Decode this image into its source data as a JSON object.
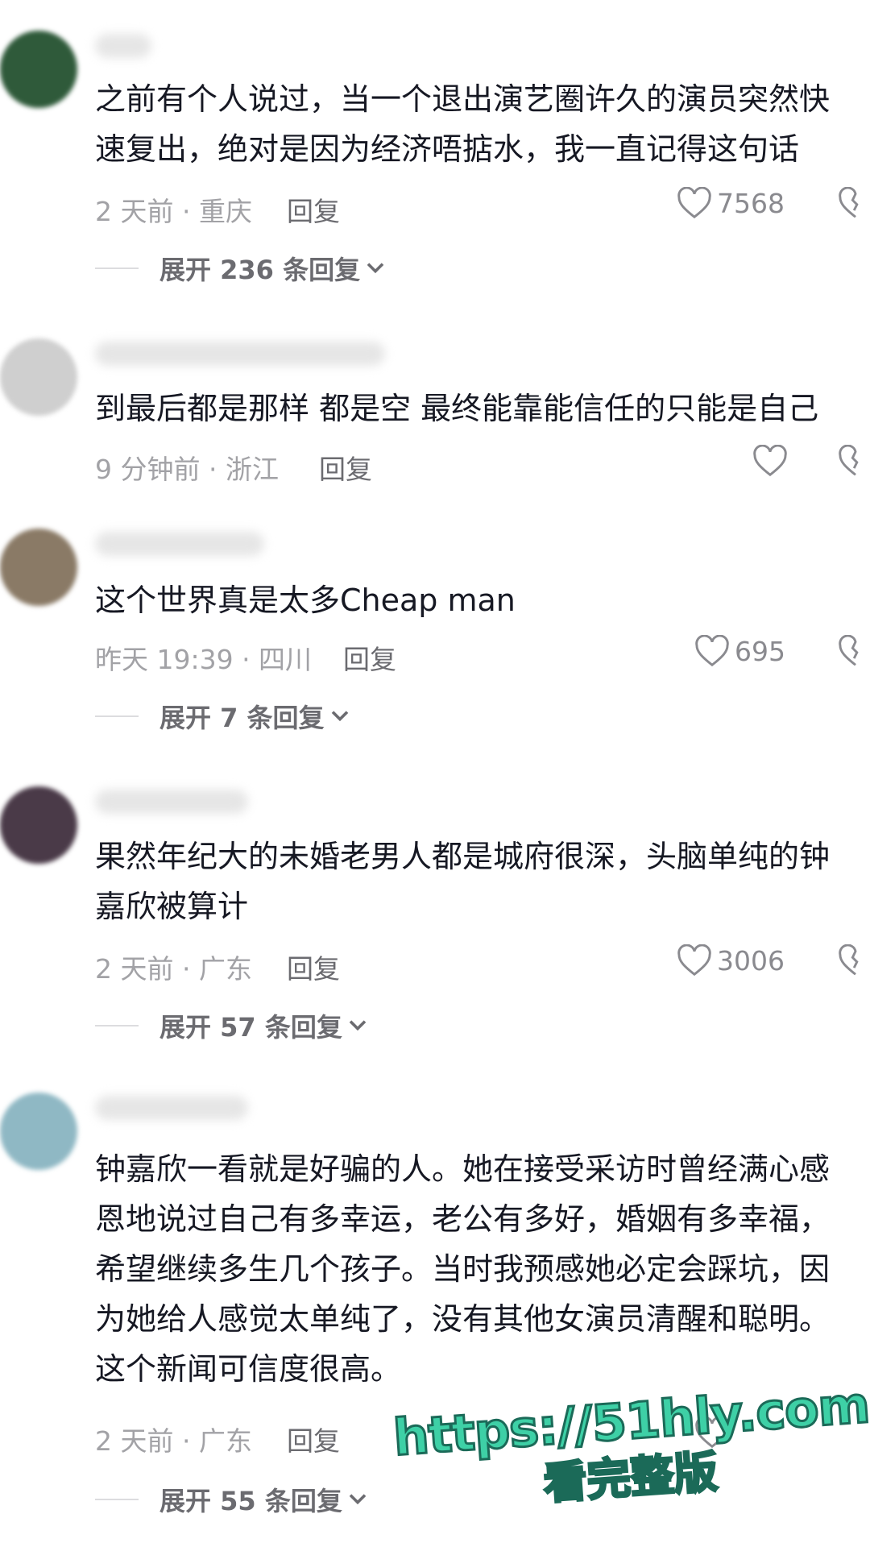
{
  "comments": [
    {
      "lines": [
        "之前有个人说过，当一个退出演艺圈许久的演员突然快",
        "速复出，绝对是因为经济唔掂水，我一直记得这句话"
      ],
      "time_location": "2 天前 · 重庆",
      "reply_label": "回复",
      "likes": "7568",
      "expand_label": "展开 236 条回复",
      "avatar_color": "#2f5a3a"
    },
    {
      "lines": [
        "到最后都是那样 都是空 最终能靠能信任的只能是自己"
      ],
      "time_location": "9 分钟前 · 浙江",
      "reply_label": "回复",
      "likes": "",
      "expand_label": "",
      "avatar_color": "#cfcfcf"
    },
    {
      "lines": [
        "这个世界真是太多Cheap man"
      ],
      "time_location": "昨天 19:39 · 四川",
      "reply_label": "回复",
      "likes": "695",
      "expand_label": "展开 7 条回复",
      "avatar_color": "#8a7a66"
    },
    {
      "lines": [
        "果然年纪大的未婚老男人都是城府很深，头脑单纯的钟",
        "嘉欣被算计"
      ],
      "time_location": "2 天前 · 广东",
      "reply_label": "回复",
      "likes": "3006",
      "expand_label": "展开 57 条回复",
      "avatar_color": "#4a3a48"
    },
    {
      "lines": [
        "钟嘉欣一看就是好骗的人。她在接受采访时曾经满心感",
        "恩地说过自己有多幸运，老公有多好，婚姻有多幸福，",
        "希望继续多生几个孩子。当时我预感她必定会踩坑，因",
        "为她给人感觉太单纯了，没有其他女演员清醒和聪明。",
        "这个新闻可信度很高。"
      ],
      "time_location": "2 天前 · 广东",
      "reply_label": "回复",
      "likes": "",
      "expand_label": "展开 55 条回复",
      "avatar_color": "#8fb8c4"
    }
  ],
  "watermark": {
    "url": "https://51hly.com",
    "subtitle": "看完整版"
  }
}
